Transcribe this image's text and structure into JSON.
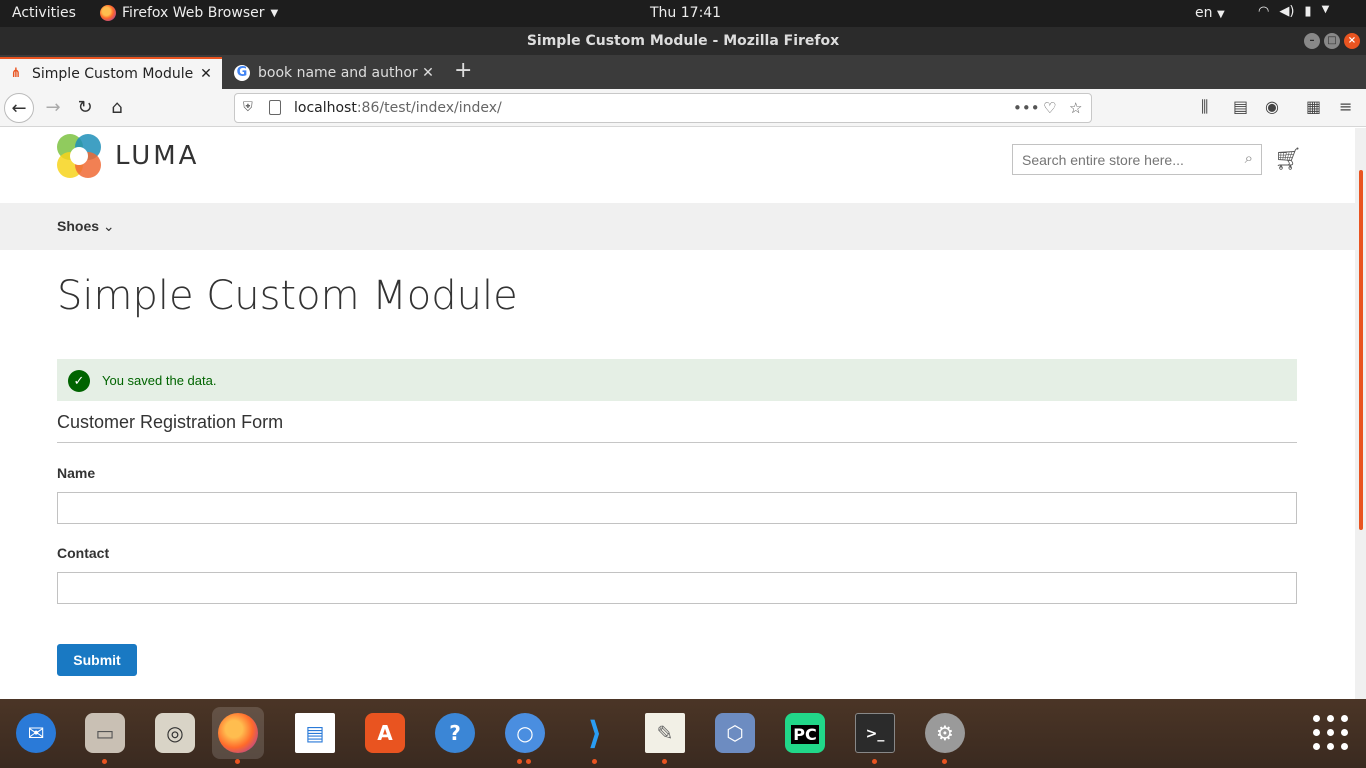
{
  "system": {
    "activities": "Activities",
    "app_name": "Firefox Web Browser",
    "clock": "Thu 17:41",
    "lang": "en"
  },
  "window": {
    "title": "Simple Custom Module - Mozilla Firefox"
  },
  "tabs": [
    {
      "label": "Simple Custom Module",
      "favicon": "magento-icon",
      "active": true
    },
    {
      "label": "book name and author -",
      "favicon": "google-icon",
      "active": false
    }
  ],
  "urlbar": {
    "host": "localhost",
    "path": ":86/test/index/index/"
  },
  "store": {
    "logo_text": "LUMA",
    "search_placeholder": "Search entire store here...",
    "menu_item": "Shoes"
  },
  "page": {
    "title": "Simple Custom Module",
    "success_message": "You saved the data.",
    "form_title": "Customer Registration Form",
    "name_label": "Name",
    "name_value": "",
    "contact_label": "Contact",
    "contact_value": "",
    "submit_label": "Submit"
  },
  "colors": {
    "accent": "#e95420",
    "button": "#1979c3",
    "success_bg": "#e5efe5",
    "success_text": "#006400"
  },
  "dock": [
    {
      "name": "thunderbird-icon"
    },
    {
      "name": "files-icon"
    },
    {
      "name": "rhythmbox-icon"
    },
    {
      "name": "firefox-icon"
    },
    {
      "name": "libreoffice-writer-icon"
    },
    {
      "name": "software-center-icon"
    },
    {
      "name": "help-icon"
    },
    {
      "name": "chromium-icon"
    },
    {
      "name": "vscode-icon"
    },
    {
      "name": "text-editor-icon"
    },
    {
      "name": "virtualbox-icon"
    },
    {
      "name": "pycharm-icon"
    },
    {
      "name": "terminal-icon"
    },
    {
      "name": "settings-icon"
    },
    {
      "name": "show-applications-icon"
    }
  ]
}
